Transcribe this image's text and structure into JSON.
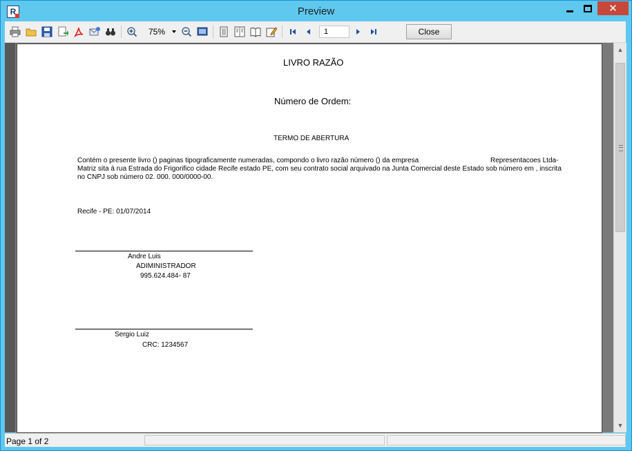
{
  "window": {
    "title": "Preview",
    "app_icon": "R",
    "controls": {
      "minimize_icon": "minimize-icon",
      "maximize_icon": "maximize-icon",
      "close_icon": "close-icon",
      "close_glyph": "✕"
    }
  },
  "toolbar": {
    "icons": [
      "print-icon",
      "open-icon",
      "save-icon",
      "export-icon",
      "pdf-icon",
      "email-icon",
      "find-icon",
      "zoom-in-icon",
      "zoom-out-icon",
      "full-page-icon",
      "single-page-icon",
      "two-pages-icon",
      "book-view-icon",
      "edit-icon",
      "first-page-icon",
      "prev-page-icon",
      "next-page-icon",
      "last-page-icon"
    ],
    "zoom_value": "75%",
    "page_number": "1",
    "close_label": "Close"
  },
  "document": {
    "title": "LIVRO RAZÃO",
    "order_number_label": "Número de Ordem:",
    "section_heading": "TERMO DE ABERTURA",
    "paragraph_line1_a": "Contém o presente livro   () paginas tipograficamente numeradas, compondo o livro razão número () da empresa",
    "paragraph_line1_b": "Representacoes Ltda-",
    "paragraph_line2": "Matriz sita à rua Estrada do Frigorifico cidade Recife estado PE, com seu contrato social arquivado na Junta Comercial deste Estado sob número  em , inscrita",
    "paragraph_line3": "no CNPJ sob número 02. 000. 000/0000-00.",
    "place_date": "Recife - PE: 01/07/2014",
    "signer1": {
      "name": "Andre Luis",
      "role": "ADIMINISTRADOR",
      "id": "995.624.484- 87"
    },
    "signer2": {
      "name": "Sergio Luiz",
      "crc": "CRC: 1234567"
    }
  },
  "status": {
    "page_info": "Page 1 of 2"
  },
  "colors": {
    "titlebar": "#5fc8ee",
    "close_button": "#c7483a",
    "viewport": "#7a7a7a"
  }
}
